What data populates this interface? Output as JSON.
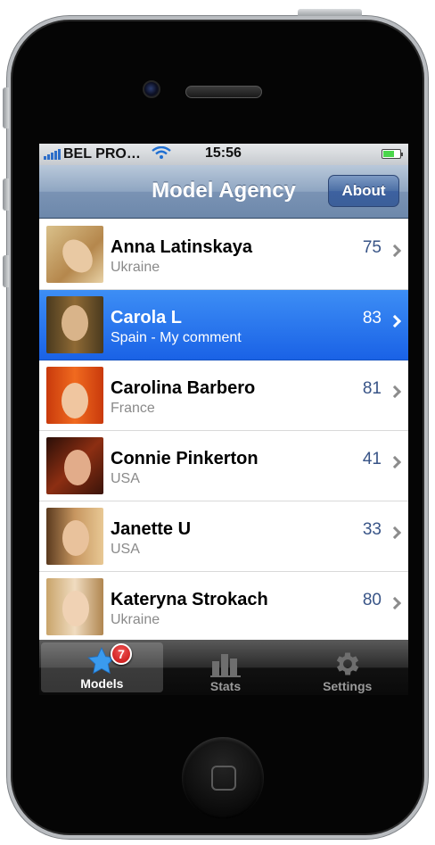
{
  "statusbar": {
    "carrier": "BEL PRO…",
    "time": "15:56",
    "battery_level": 0.65
  },
  "navbar": {
    "title": "Model Agency",
    "about_label": "About"
  },
  "models": [
    {
      "name": "Anna Latinskaya",
      "subtitle": "Ukraine",
      "score": "75",
      "selected": false
    },
    {
      "name": "Carola L",
      "subtitle": "Spain - My comment",
      "score": "83",
      "selected": true
    },
    {
      "name": "Carolina Barbero",
      "subtitle": "France",
      "score": "81",
      "selected": false
    },
    {
      "name": "Connie Pinkerton",
      "subtitle": "USA",
      "score": "41",
      "selected": false
    },
    {
      "name": "Janette U",
      "subtitle": "USA",
      "score": "33",
      "selected": false
    },
    {
      "name": "Kateryna Strokach",
      "subtitle": "Ukraine",
      "score": "80",
      "selected": false
    }
  ],
  "tabbar": {
    "tabs": [
      {
        "label": "Models",
        "icon": "star-icon",
        "active": true,
        "badge": "7"
      },
      {
        "label": "Stats",
        "icon": "bar-chart-icon",
        "active": false
      },
      {
        "label": "Settings",
        "icon": "gear-icon",
        "active": false
      }
    ]
  },
  "colors": {
    "selection": "#1a62e6",
    "score_text": "#385487",
    "badge": "#d01a1a"
  }
}
